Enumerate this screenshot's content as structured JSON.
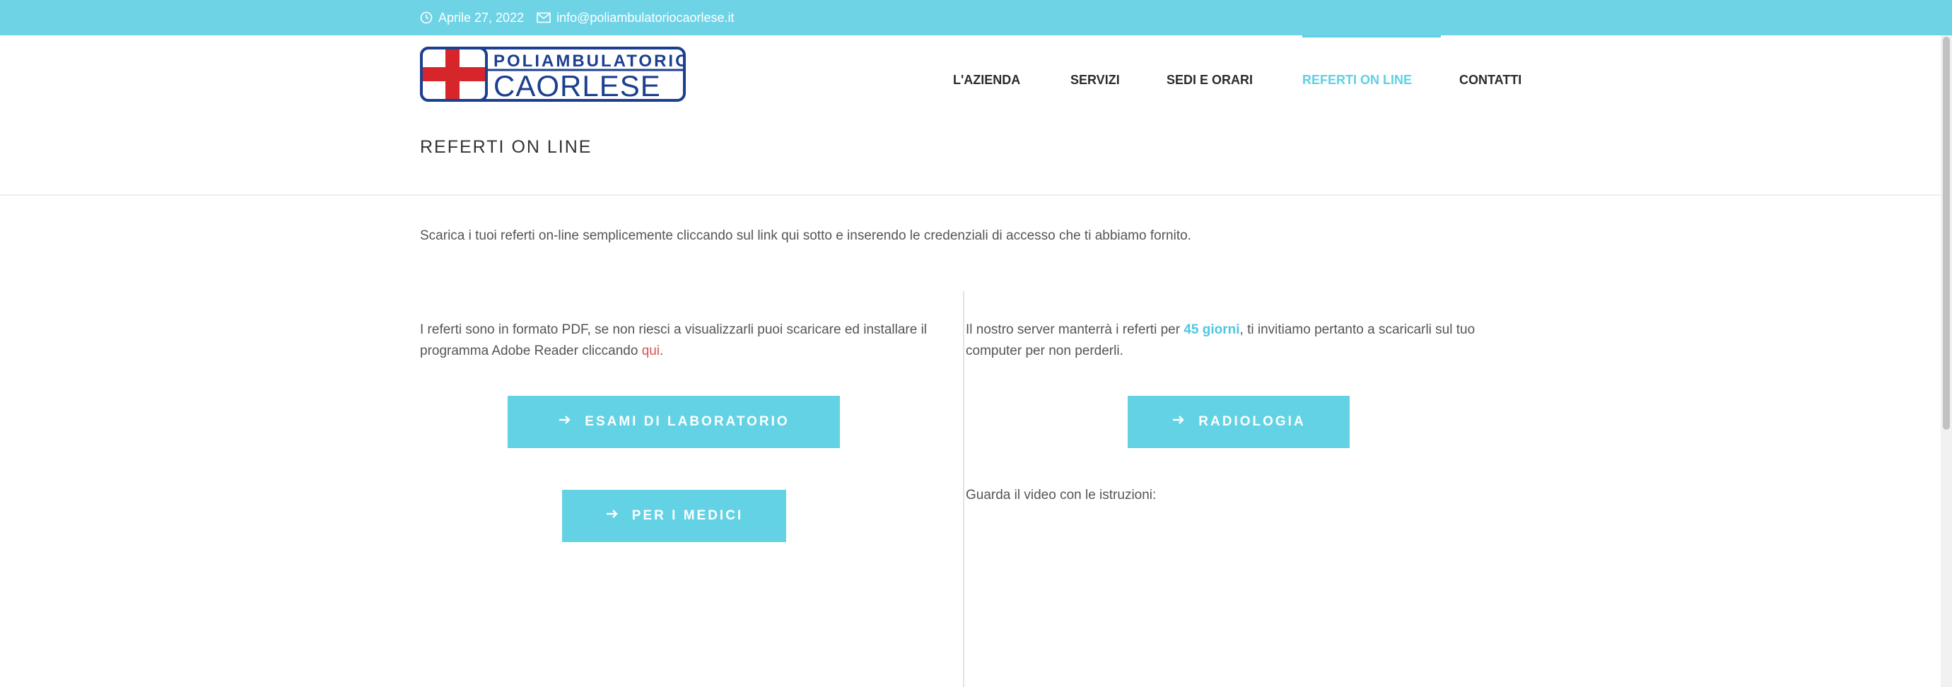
{
  "topbar": {
    "date": "Aprile 27, 2022",
    "email": "info@poliambulatoriocaorlese.it",
    "clock_icon": "clock-icon",
    "mail_icon": "mail-icon"
  },
  "logo": {
    "line1": "POLIAMBULATORIO",
    "line2": "CAORLESE"
  },
  "nav": {
    "items": [
      {
        "label": "L'AZIENDA"
      },
      {
        "label": "SERVIZI"
      },
      {
        "label": "SEDI E ORARI"
      },
      {
        "label": "REFERTI ON LINE",
        "active": true
      },
      {
        "label": "CONTATTI"
      }
    ]
  },
  "page": {
    "title": "REFERTI ON LINE",
    "intro": "Scarica i tuoi referti on-line semplicemente cliccando sul link qui sotto e inserendo le credenziali di accesso che ti abbiamo fornito."
  },
  "left": {
    "note_part1": "I referti sono in formato PDF, se non riesci a visualizzarli puoi scaricare ed installare il programma Adobe Reader cliccando ",
    "note_link": "qui",
    "note_end": ".",
    "btn_lab": "ESAMI DI LABORATORIO",
    "btn_medici": "PER I MEDICI"
  },
  "right": {
    "note_part1": "Il nostro server manterrà i referti per ",
    "note_highlight": "45 giorni",
    "note_part2": ", ti invitiamo pertanto a scaricarli sul tuo computer per non perderli.",
    "btn_radio": "RADIOLOGIA",
    "video_label": "Guarda il video con le istruzioni:"
  },
  "colors": {
    "accent": "#63d2e5",
    "topbar": "#6fd3e6",
    "logo_blue": "#1d3f8f",
    "logo_red": "#d6262c"
  }
}
